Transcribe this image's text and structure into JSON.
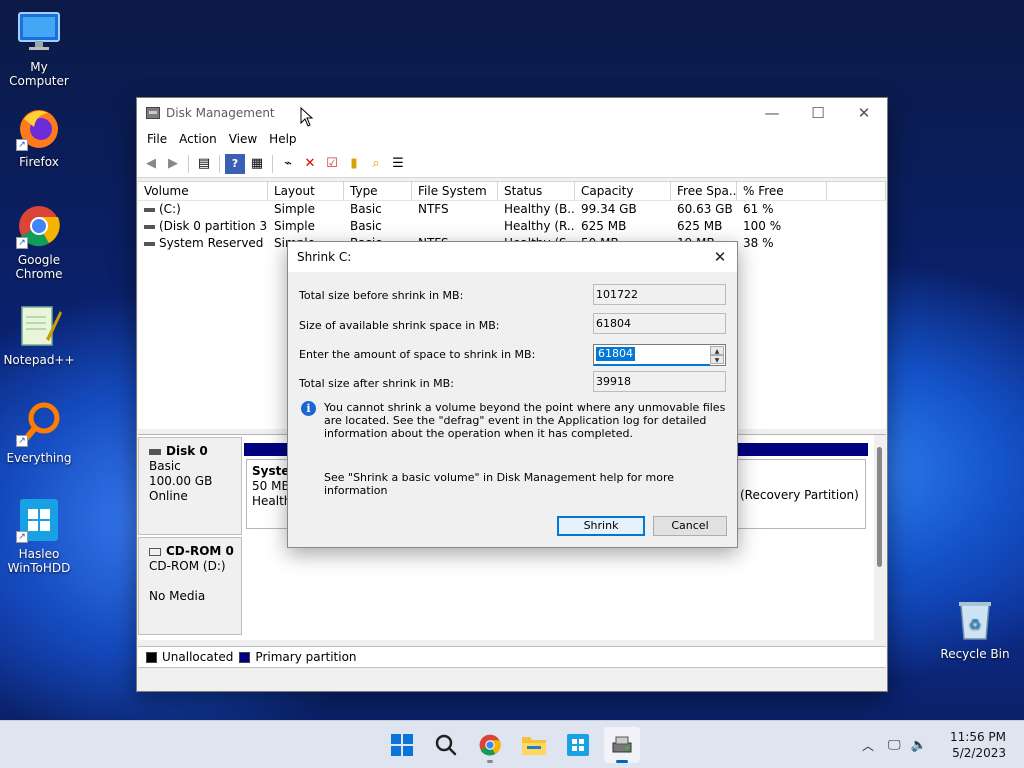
{
  "desktop": {
    "icons": [
      {
        "label": "My Computer"
      },
      {
        "label": "Firefox"
      },
      {
        "label": "Google Chrome"
      },
      {
        "label": "Notepad++"
      },
      {
        "label": "Everything"
      },
      {
        "label": "Hasleo WinToHDD"
      },
      {
        "label": "Recycle Bin"
      }
    ]
  },
  "window": {
    "title": "Disk Management",
    "menu": [
      "File",
      "Action",
      "View",
      "Help"
    ],
    "columns": [
      "Volume",
      "Layout",
      "Type",
      "File System",
      "Status",
      "Capacity",
      "Free Spa...",
      "% Free"
    ],
    "volumes": [
      [
        "(C:)",
        "Simple",
        "Basic",
        "NTFS",
        "Healthy (B...",
        "99.34 GB",
        "60.63 GB",
        "61 %"
      ],
      [
        "(Disk 0 partition 3)",
        "Simple",
        "Basic",
        "",
        "Healthy (R...",
        "625 MB",
        "625 MB",
        "100 %"
      ],
      [
        "System Reserved",
        "Simple",
        "Basic",
        "NTFS",
        "Healthy (S...",
        "50 MB",
        "19 MB",
        "38 %"
      ]
    ],
    "disks": {
      "disk0": {
        "name": "Disk 0",
        "type": "Basic",
        "size": "100.00 GB",
        "state": "Online",
        "part_name": "System",
        "part_size": "50 MB",
        "part_status": "Healthy",
        "recovery": "(Recovery Partition)"
      },
      "cdrom": {
        "name": "CD-ROM 0",
        "type": "CD-ROM (D:)",
        "state": "No Media"
      }
    },
    "legend": {
      "unallocated": "Unallocated",
      "primary": "Primary partition",
      "unallocated_color": "#000000",
      "primary_color": "#000080"
    }
  },
  "dialog": {
    "title": "Shrink C:",
    "total_before_label": "Total size before shrink in MB:",
    "total_before_value": "101722",
    "available_label": "Size of available shrink space in MB:",
    "available_value": "61804",
    "amount_label": "Enter the amount of space to shrink in MB:",
    "amount_value": "61804",
    "after_label": "Total size after shrink in MB:",
    "after_value": "39918",
    "info": "You cannot shrink a volume beyond the point where any unmovable files are located. See the \"defrag\" event in the Application log for detailed information about the operation when it has completed.",
    "help": "See \"Shrink a basic volume\" in Disk Management help for more information",
    "shrink_label": "Shrink",
    "cancel_label": "Cancel"
  },
  "taskbar": {
    "time": "11:56 PM",
    "date": "5/2/2023"
  }
}
